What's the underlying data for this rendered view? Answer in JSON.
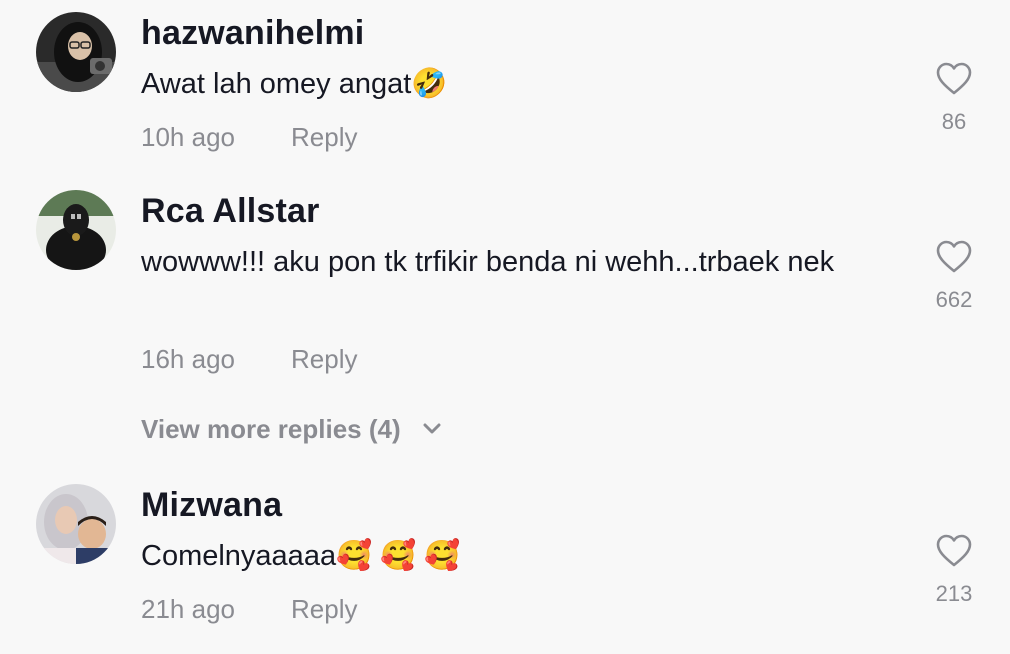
{
  "comments": [
    {
      "username": "hazwanihelmi",
      "text": "Awat lah omey angat🤣",
      "time": "10h ago",
      "reply_label": "Reply",
      "like_count": "86"
    },
    {
      "username": "Rca Allstar",
      "text": "wowww!!! aku pon tk trfikir benda ni wehh...trbaek nek",
      "time": "16h ago",
      "reply_label": "Reply",
      "like_count": "662"
    },
    {
      "username": "Mizwana",
      "text": "Comelnyaaaaa🥰 🥰 🥰",
      "time": "21h ago",
      "reply_label": "Reply",
      "like_count": "213"
    }
  ],
  "view_more": {
    "label": "View more replies (4)"
  },
  "colors": {
    "background": "#f8f8f8",
    "text_primary": "#161823",
    "text_secondary": "#8a8b91"
  },
  "icons": {
    "like": "heart-outline-icon",
    "expand": "chevron-down-icon"
  }
}
